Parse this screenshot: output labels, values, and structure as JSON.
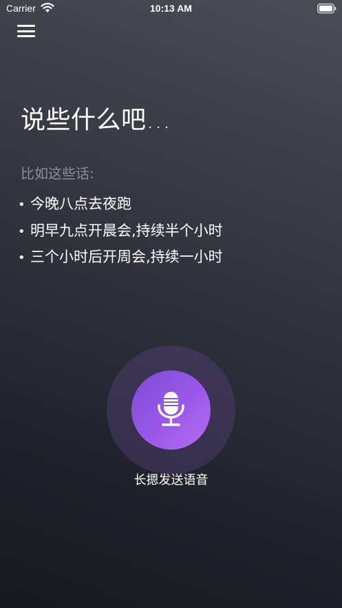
{
  "status_bar": {
    "carrier": "Carrier",
    "time": "10:13 AM",
    "wifi_icon": "wifi-icon",
    "battery_icon": "battery-icon"
  },
  "menu": {
    "icon": "hamburger-menu-icon"
  },
  "main": {
    "title": "说些什么吧...",
    "hint": "比如这些话:",
    "examples": [
      "今晚八点去夜跑",
      "明早九点开晨会,持续半个小时",
      "三个小时后开周会,持续一小时"
    ]
  },
  "voice": {
    "icon": "microphone-icon",
    "label": "长摁发送语音",
    "accent_color": "#9a58e8"
  }
}
